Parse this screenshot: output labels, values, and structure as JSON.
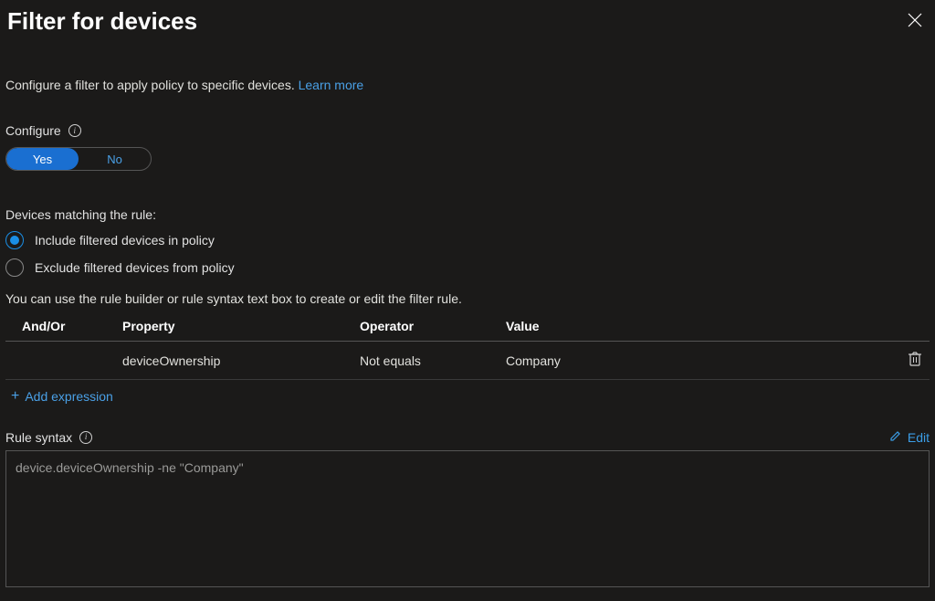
{
  "header": {
    "title": "Filter for devices"
  },
  "description": {
    "text": "Configure a filter to apply policy to specific devices. ",
    "link": "Learn more"
  },
  "configure": {
    "label": "Configure",
    "yes": "Yes",
    "no": "No",
    "selected": "Yes"
  },
  "matching": {
    "label": "Devices matching the rule:",
    "include": "Include filtered devices in policy",
    "exclude": "Exclude filtered devices from policy",
    "selected": "include"
  },
  "hint": "You can use the rule builder or rule syntax text box to create or edit the filter rule.",
  "table": {
    "headers": {
      "andor": "And/Or",
      "property": "Property",
      "operator": "Operator",
      "value": "Value"
    },
    "rows": [
      {
        "andor": "",
        "property": "deviceOwnership",
        "operator": "Not equals",
        "value": "Company"
      }
    ]
  },
  "add_expression": "Add expression",
  "syntax": {
    "label": "Rule syntax",
    "edit": "Edit",
    "value": "device.deviceOwnership -ne \"Company\""
  }
}
